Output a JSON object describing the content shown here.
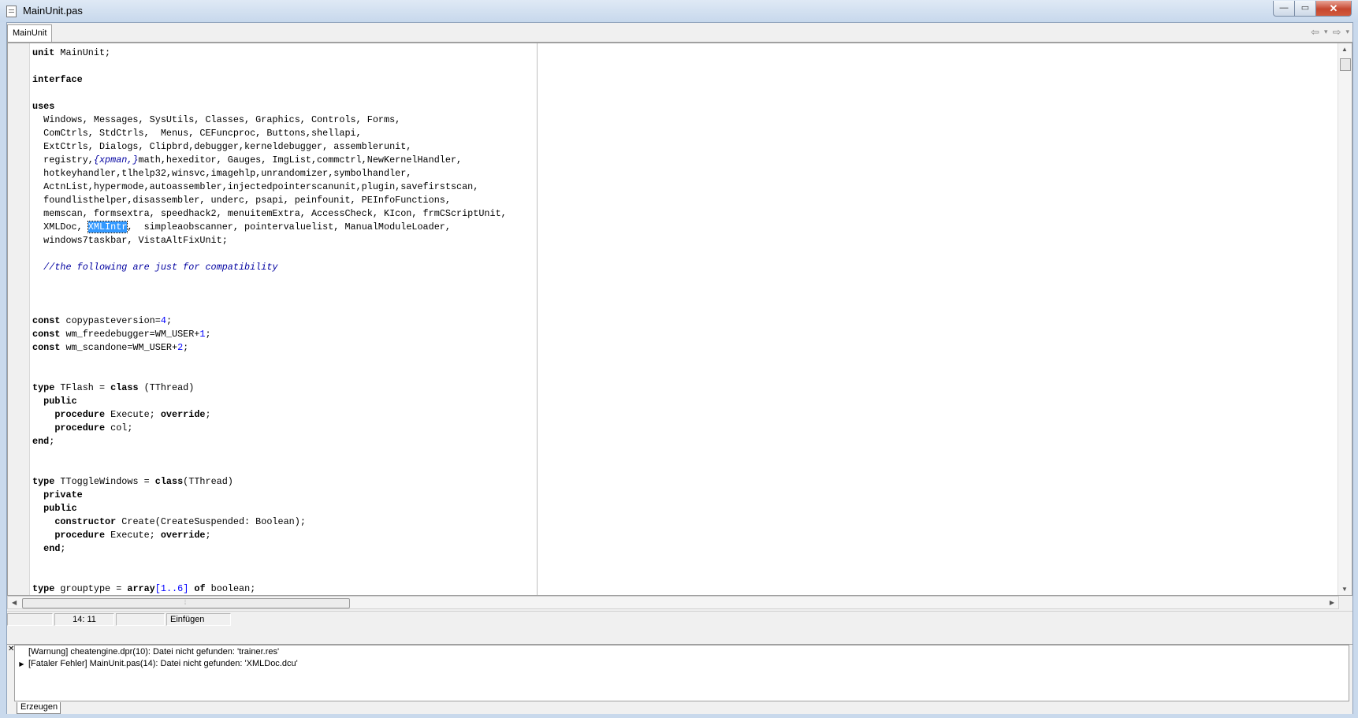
{
  "window": {
    "title": "MainUnit.pas",
    "minimize_glyph": "—",
    "maximize_glyph": "▭",
    "close_glyph": "✕"
  },
  "tabs": [
    {
      "label": "MainUnit"
    }
  ],
  "nav": {
    "back_glyph": "⇦",
    "dropdown_glyph": "▾",
    "forward_glyph": "⇨"
  },
  "editor": {
    "selected_word": "XMLIntr",
    "lines": [
      "unit MainUnit;",
      "",
      "interface",
      "",
      "uses",
      "  Windows, Messages, SysUtils, Classes, Graphics, Controls, Forms,",
      "  ComCtrls, StdCtrls,  Menus, CEFuncproc, Buttons,shellapi,",
      "  ExtCtrls, Dialogs, Clipbrd,debugger,kerneldebugger, assemblerunit,",
      "  registry,{xpman,}math,hexeditor, Gauges, ImgList,commctrl,NewKernelHandler,",
      "  hotkeyhandler,tlhelp32,winsvc,imagehlp,unrandomizer,symbolhandler,",
      "  ActnList,hypermode,autoassembler,injectedpointerscanunit,plugin,savefirstscan,",
      "  foundlisthelper,disassembler, underc, psapi, peinfounit, PEInfoFunctions,",
      "  memscan, formsextra, speedhack2, menuitemExtra, AccessCheck, KIcon, frmCScriptUnit,",
      "  XMLDoc, XMLIntr,  simpleaobscanner, pointervaluelist, ManualModuleLoader,",
      "  windows7taskbar, VistaAltFixUnit;",
      "",
      "  //the following are just for compatibility",
      "",
      "",
      "",
      "const copypasteversion=4;",
      "const wm_freedebugger=WM_USER+1;",
      "const wm_scandone=WM_USER+2;",
      "",
      "",
      "type TFlash = class (TThread)",
      "  public",
      "    procedure Execute; override;",
      "    procedure col;",
      "end;",
      "",
      "",
      "type TToggleWindows = class(TThread)",
      "  private",
      "  public",
      "    constructor Create(CreateSuspended: Boolean);",
      "    procedure Execute; override;",
      "  end;",
      "",
      "",
      "type grouptype = array[1..6] of boolean;"
    ]
  },
  "statusbar": {
    "position": "14:  11",
    "mode": "Einfügen"
  },
  "messages": {
    "close_glyph": "✕",
    "items": [
      {
        "marker": "",
        "text": "[Warnung] cheatengine.dpr(10): Datei nicht gefunden: 'trainer.res'"
      },
      {
        "marker": "▶",
        "text": "[Fataler Fehler] MainUnit.pas(14): Datei nicht gefunden: 'XMLDoc.dcu'"
      }
    ],
    "tab_label": "Erzeugen"
  },
  "scroll_glyphs": {
    "up": "▲",
    "down": "▼",
    "left": "◀",
    "right": "▶",
    "grip": "⦙"
  }
}
